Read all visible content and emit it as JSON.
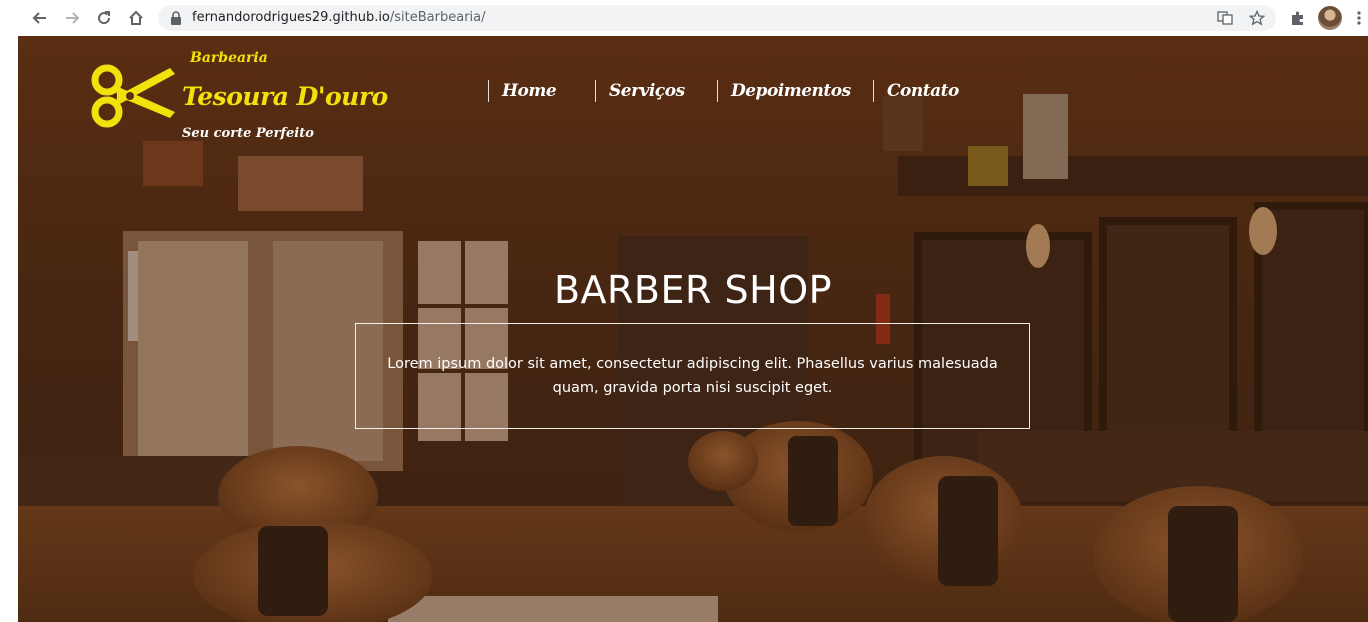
{
  "browser": {
    "back_icon": "arrow-left-icon",
    "forward_icon": "arrow-right-icon",
    "reload_icon": "reload-icon",
    "home_icon": "home-icon",
    "url_host": "fernandorodrigues29.github.io",
    "url_path": "/siteBarbearia/"
  },
  "logo": {
    "small": "Barbearia",
    "title": "Tesoura D'ouro",
    "tagline": "Seu corte Perfeito",
    "color": "#f2e20c"
  },
  "menu": {
    "items": [
      {
        "label": "Home"
      },
      {
        "label": "Serviços"
      },
      {
        "label": "Depoimentos"
      },
      {
        "label": "Contato"
      }
    ]
  },
  "hero": {
    "title": "BARBER SHOP",
    "text": "Lorem ipsum dolor sit amet, consectetur adipiscing elit. Phasellus varius malesuada quam, gravida porta nisi suscipit eget."
  }
}
